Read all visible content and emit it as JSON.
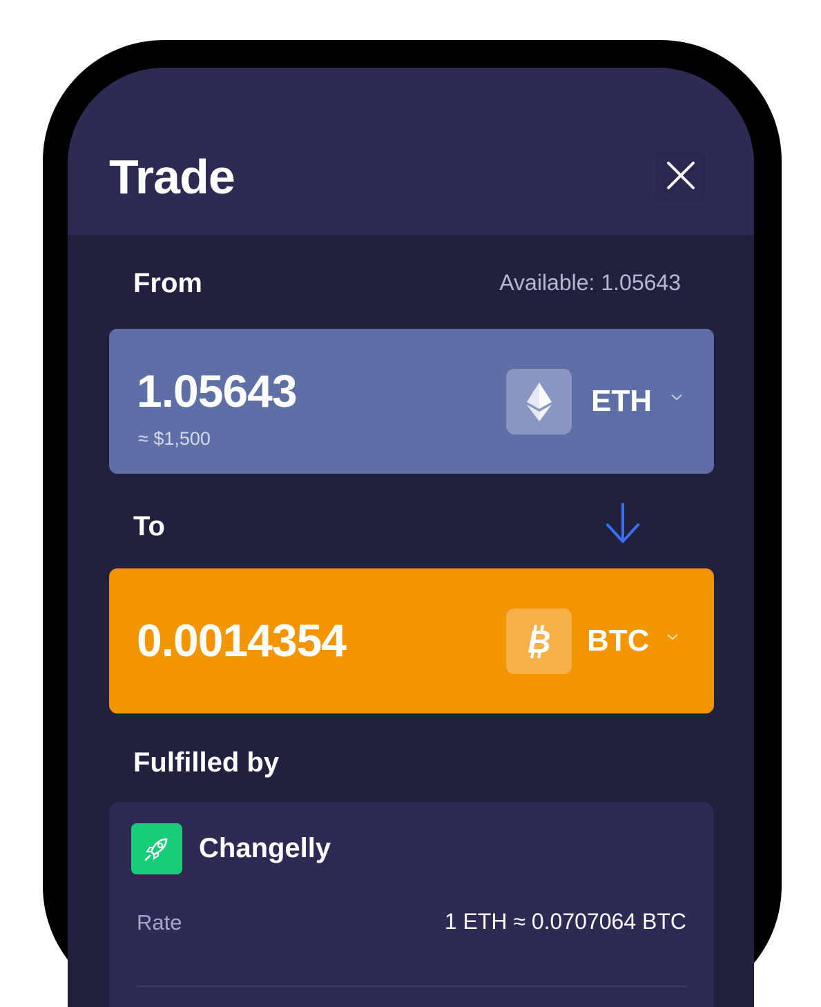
{
  "header": {
    "title": "Trade"
  },
  "from": {
    "label": "From",
    "available": "Available: 1.05643",
    "amount": "1.05643",
    "fiat": "≈ $1,500",
    "ticker": "ETH",
    "icon": "ethereum-icon",
    "color": "#5e6fa6"
  },
  "to": {
    "label": "To",
    "amount": "0.0014354",
    "ticker": "BTC",
    "icon": "bitcoin-icon",
    "color": "#f29500"
  },
  "fulfilled": {
    "label": "Fulfilled by",
    "provider": "Changelly",
    "provider_icon": "rocket-icon",
    "rate_label": "Rate",
    "rate_value": "1 ETH ≈ 0.0707064 BTC"
  },
  "colors": {
    "background": "#21203f",
    "header": "#2d2a54",
    "accent_arrow": "#3b6ef0",
    "provider_green": "#18cd7a"
  }
}
